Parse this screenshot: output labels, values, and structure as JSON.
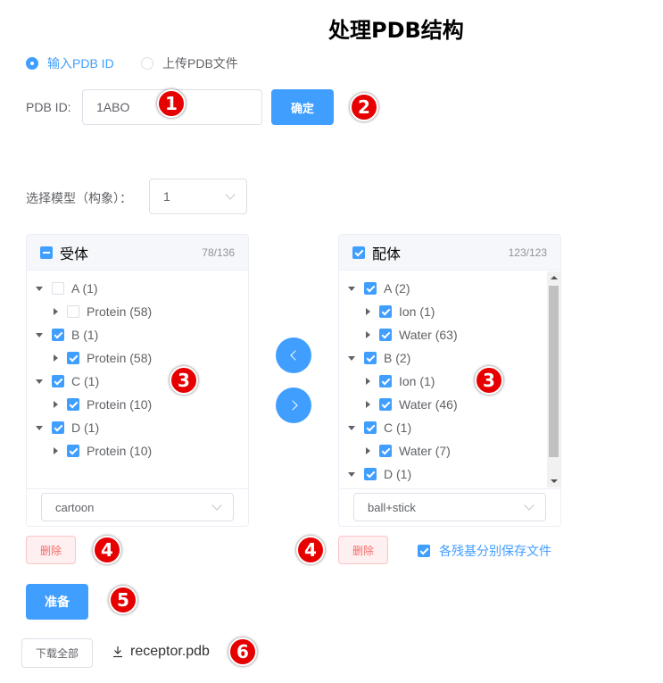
{
  "page": {
    "title": "处理PDB结构"
  },
  "source_mode": {
    "options": [
      {
        "label": "输入PDB ID",
        "selected": true
      },
      {
        "label": "上传PDB文件",
        "selected": false
      }
    ]
  },
  "pdb_id": {
    "label": "PDB ID:",
    "value": "1ABO",
    "confirm_label": "确定"
  },
  "model_select": {
    "label": "选择模型（构象）：",
    "value": "1"
  },
  "receptor": {
    "title": "受体",
    "count": "78/136",
    "header_state": "indeterminate",
    "nodes": [
      {
        "label": "A (1)",
        "checked": false,
        "level": 0,
        "expanded": true
      },
      {
        "label": "Protein (58)",
        "checked": false,
        "level": 1,
        "expanded": false
      },
      {
        "label": "B (1)",
        "checked": true,
        "level": 0,
        "expanded": true
      },
      {
        "label": "Protein (58)",
        "checked": true,
        "level": 1,
        "expanded": false
      },
      {
        "label": "C (1)",
        "checked": true,
        "level": 0,
        "expanded": true
      },
      {
        "label": "Protein (10)",
        "checked": true,
        "level": 1,
        "expanded": false
      },
      {
        "label": "D (1)",
        "checked": true,
        "level": 0,
        "expanded": true
      },
      {
        "label": "Protein (10)",
        "checked": true,
        "level": 1,
        "expanded": false
      }
    ],
    "style": "cartoon",
    "delete_label": "删除"
  },
  "ligand": {
    "title": "配体",
    "count": "123/123",
    "header_state": "checked",
    "nodes": [
      {
        "label": "A (2)",
        "checked": true,
        "level": 0,
        "expanded": true
      },
      {
        "label": "Ion (1)",
        "checked": true,
        "level": 1,
        "expanded": false
      },
      {
        "label": "Water (63)",
        "checked": true,
        "level": 1,
        "expanded": false
      },
      {
        "label": "B (2)",
        "checked": true,
        "level": 0,
        "expanded": true
      },
      {
        "label": "Ion (1)",
        "checked": true,
        "level": 1,
        "expanded": false
      },
      {
        "label": "Water (46)",
        "checked": true,
        "level": 1,
        "expanded": false
      },
      {
        "label": "C (1)",
        "checked": true,
        "level": 0,
        "expanded": true
      },
      {
        "label": "Water (7)",
        "checked": true,
        "level": 1,
        "expanded": false
      },
      {
        "label": "D (1)",
        "checked": true,
        "level": 0,
        "expanded": true
      }
    ],
    "style": "ball+stick",
    "delete_label": "删除",
    "save_per_residue": {
      "label": "各残基分别保存文件",
      "checked": true
    }
  },
  "prepare": {
    "label": "准备"
  },
  "download": {
    "all_label": "下载全部",
    "file": "receptor.pdb"
  },
  "annotations": [
    "1",
    "2",
    "3",
    "3",
    "4",
    "4",
    "5",
    "6"
  ],
  "colors": {
    "primary": "#409eff",
    "danger": "#f56c6c",
    "badge": "#e60000"
  }
}
